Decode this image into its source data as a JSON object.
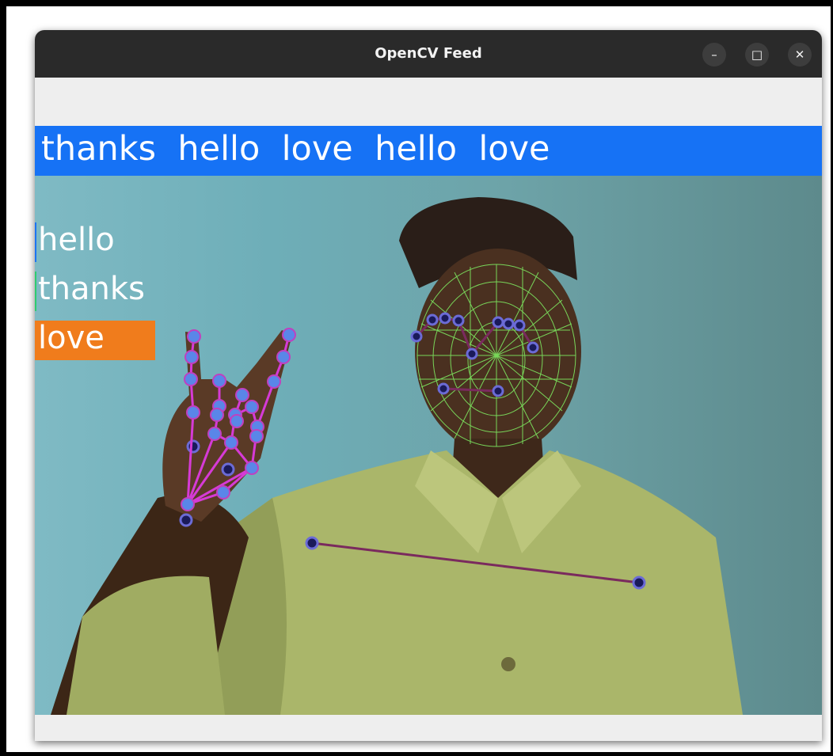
{
  "window": {
    "title": "OpenCV Feed",
    "controls": {
      "minimize": "–",
      "maximize": "□",
      "close": "✕"
    }
  },
  "sentence_bar": {
    "text": "thanks  hello  love  hello  love",
    "color": "#1672f5"
  },
  "probabilities": [
    {
      "label": "hello",
      "value": 0.01,
      "color": "#1c75f2"
    },
    {
      "label": "thanks",
      "value": 0.01,
      "color": "#2ecc71"
    },
    {
      "label": "love",
      "value": 0.98,
      "color": "#f07c1c"
    }
  ],
  "landmark_colors": {
    "hand_line": "#d63ad6",
    "hand_point": "#5a86e8",
    "pose_line": "#7a2a5e",
    "pose_point": "#1a1a5a",
    "face_mesh": "#7ee860"
  }
}
